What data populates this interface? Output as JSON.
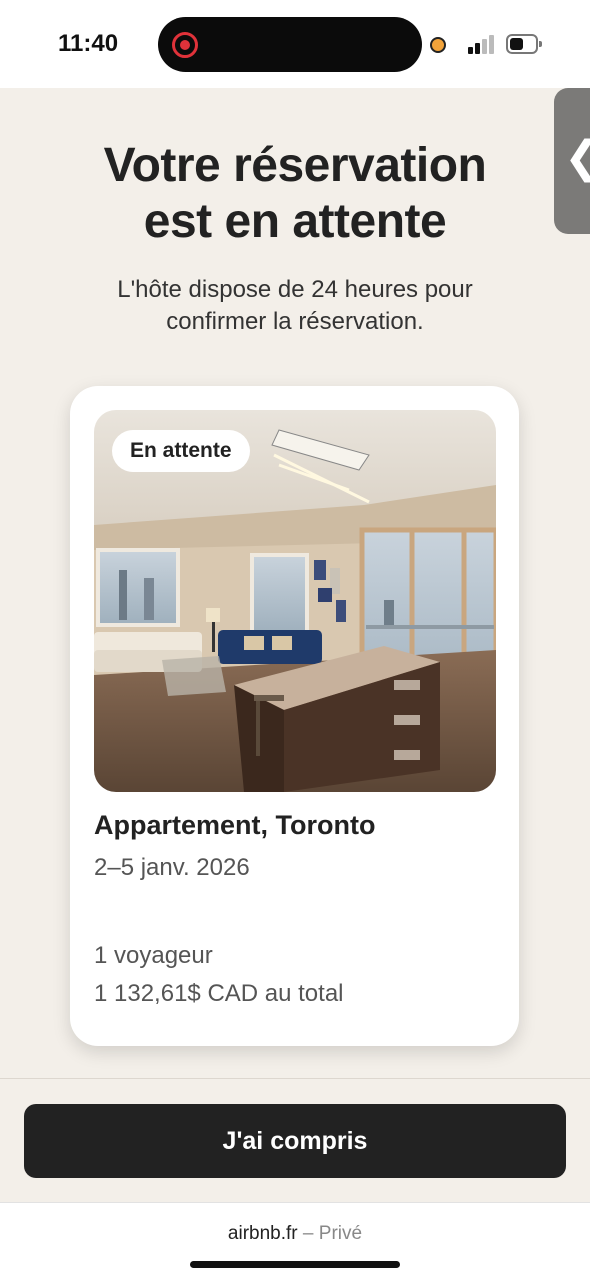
{
  "status_bar": {
    "time": "11:40",
    "icons": [
      "screen-record-icon",
      "mic-indicator-icon",
      "signal-icon",
      "battery-icon"
    ]
  },
  "side_handle": {
    "icon": "chevron-left-icon",
    "glyph": "❮"
  },
  "header": {
    "title_line1": "Votre réservation",
    "title_line2": "est en attente",
    "subtitle": "L'hôte dispose de 24 heures pour confirmer la réservation."
  },
  "card": {
    "badge": "En attente",
    "photo_icon": "apartment-photo",
    "listing_title": "Appartement, Toronto",
    "dates": "2–5 janv. 2026",
    "guests": "1 voyageur",
    "total": "1 132,61$ CAD au total"
  },
  "actions": {
    "confirm_label": "J'ai compris"
  },
  "browser": {
    "domain": "airbnb.fr",
    "separator": "–",
    "mode": "Privé"
  },
  "colors": {
    "background": "#f3efe9",
    "button": "#222222",
    "text": "#222222",
    "recording": "#e0323a"
  }
}
